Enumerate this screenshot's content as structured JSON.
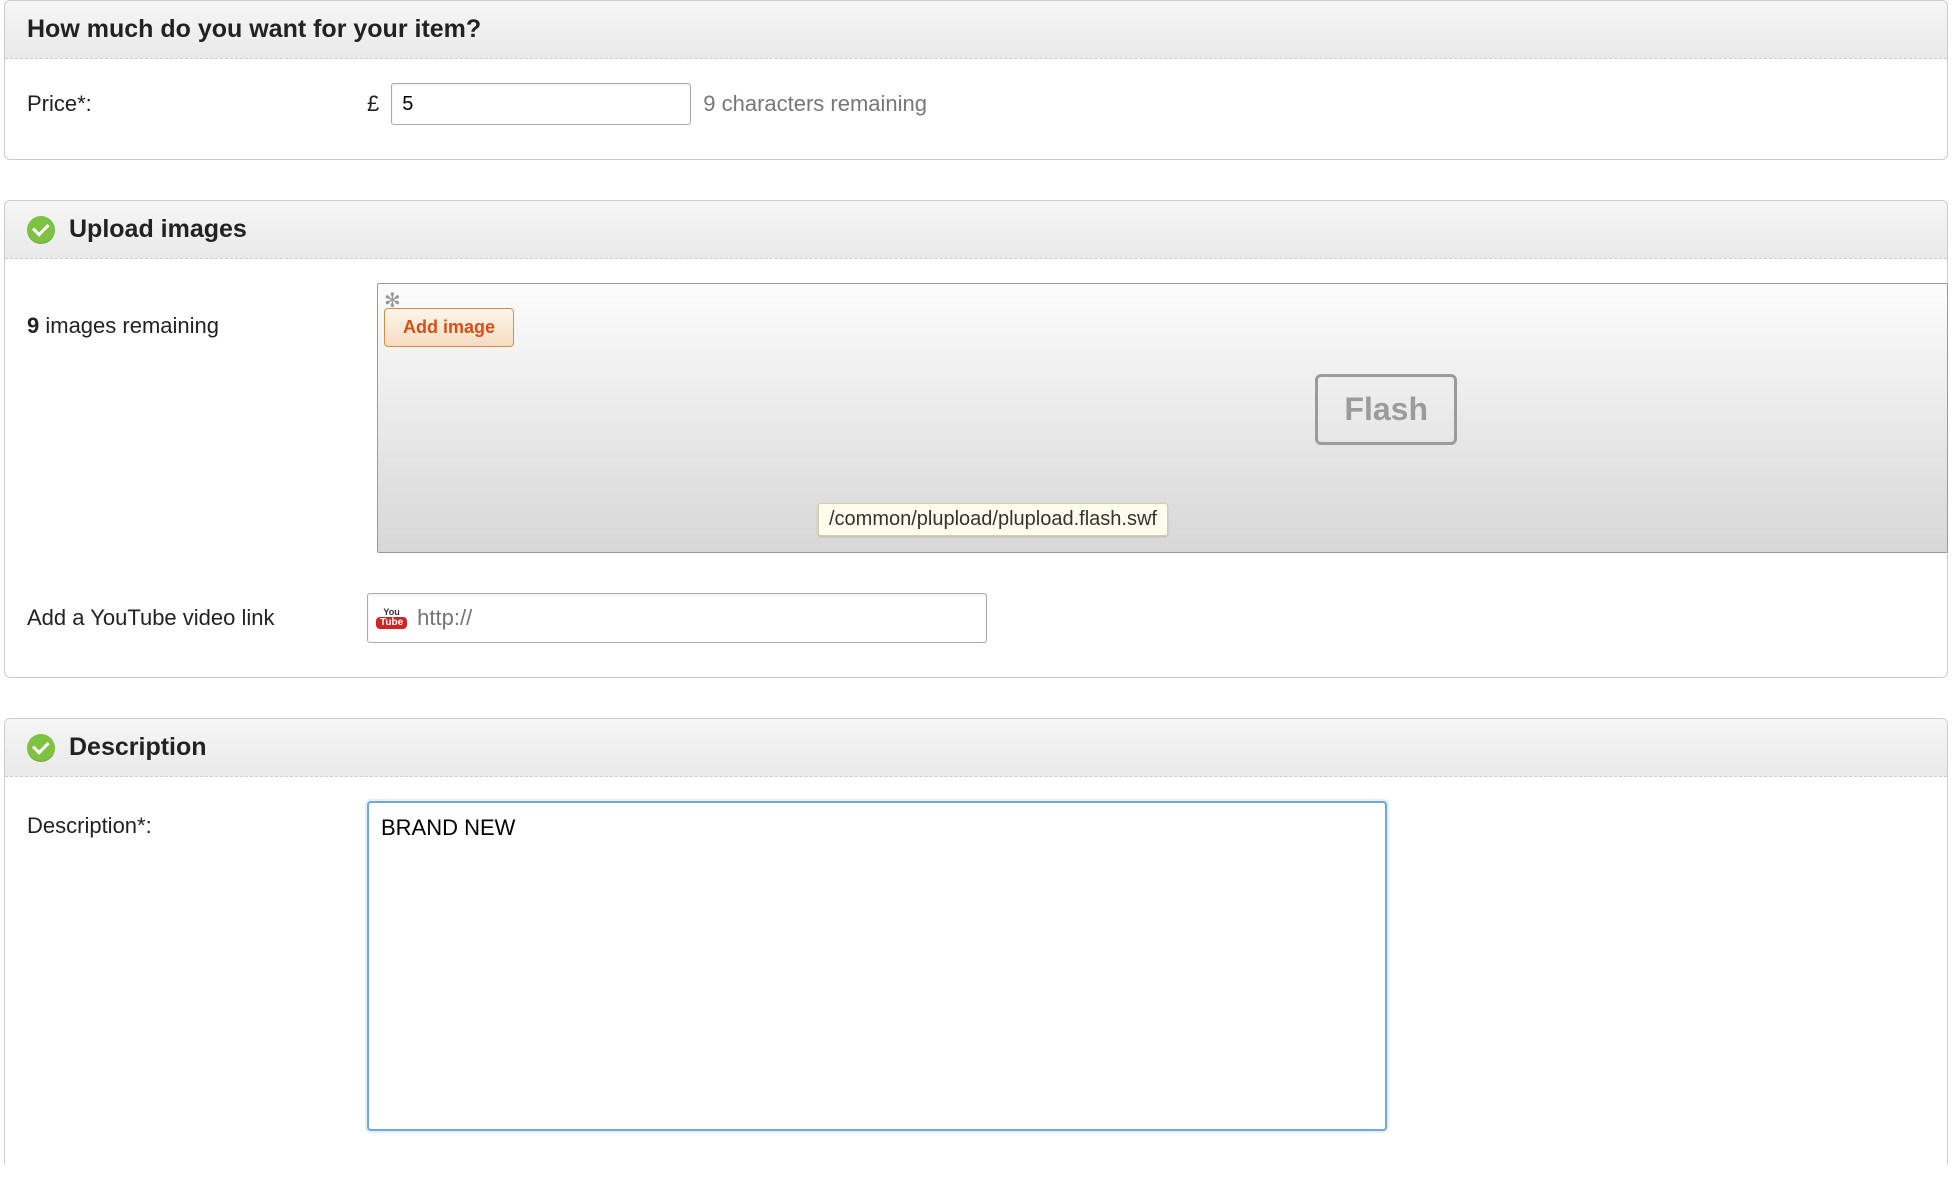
{
  "price_section": {
    "title": "How much do you want for your item?",
    "label": "Price*:",
    "currency": "£",
    "value": "5",
    "hint": "9 characters remaining"
  },
  "upload_section": {
    "title": "Upload images",
    "remaining_count": "9",
    "remaining_text": " images remaining",
    "add_button": "Add image",
    "flash_label": "Flash",
    "tooltip": "/common/plupload/plupload.flash.swf",
    "youtube_label": "Add a YouTube video link",
    "youtube_placeholder": "http://",
    "youtube_icon_top": "You",
    "youtube_icon_bot": "Tube"
  },
  "description_section": {
    "title": "Description",
    "label": "Description*:",
    "value": "BRAND NEW "
  }
}
